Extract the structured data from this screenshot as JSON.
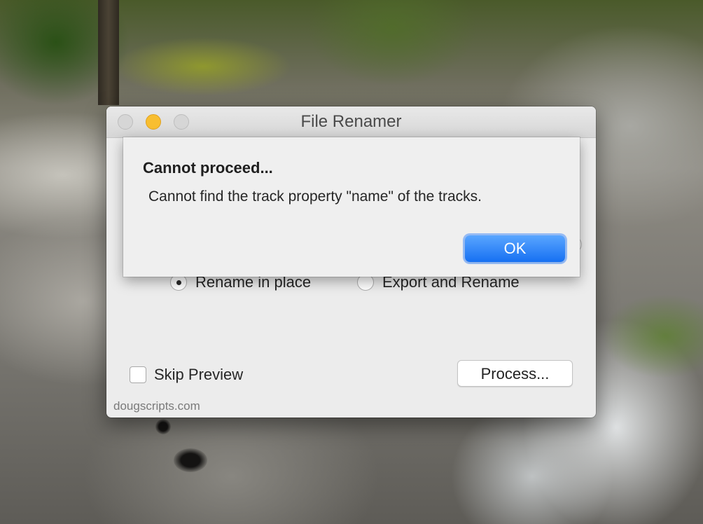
{
  "window": {
    "title": "File Renamer"
  },
  "alert": {
    "title": "Cannot proceed...",
    "message": "Cannot find the track property \"name\" of the tracks.",
    "ok_label": "OK"
  },
  "options": {
    "rename_in_place_label": "Rename in place",
    "rename_in_place_selected": true,
    "export_and_rename_label": "Export and Rename",
    "export_and_rename_selected": false
  },
  "skip_preview": {
    "label": "Skip Preview",
    "checked": false
  },
  "process_button_label": "Process...",
  "footer_text": "dougscripts.com",
  "colors": {
    "ok_button": "#1670f2",
    "minimize_button": "#f8be30"
  }
}
